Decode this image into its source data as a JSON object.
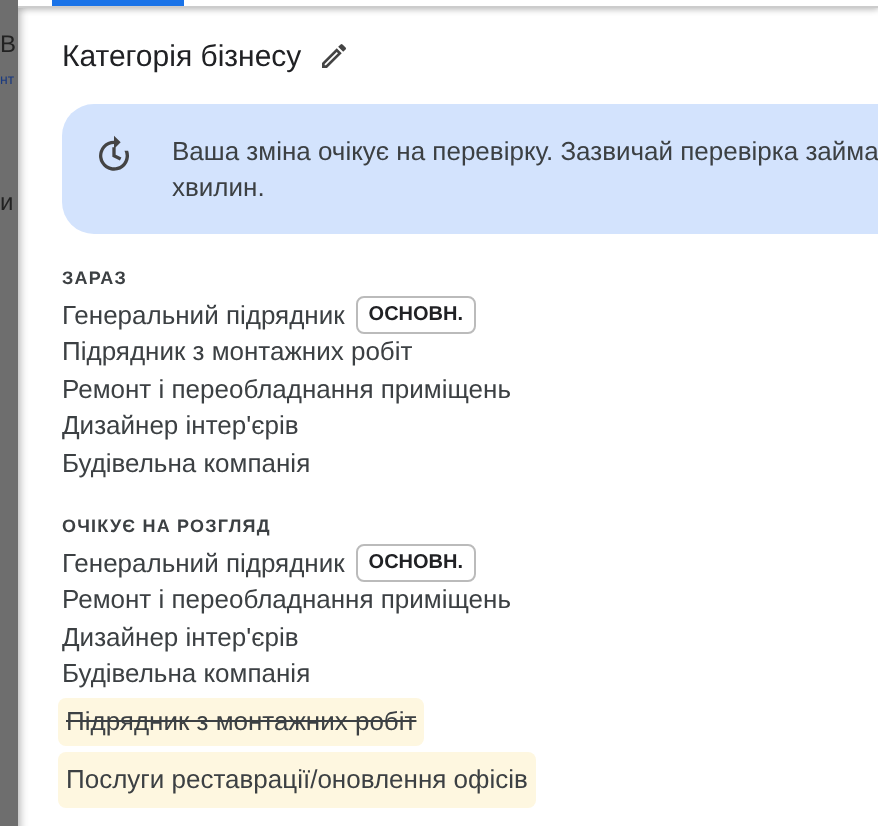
{
  "background_fragments": [
    "В",
    "нт",
    "и"
  ],
  "title": "Категорія бізнесу",
  "notice": {
    "lines": [
      "Ваша зміна очікує на перевірку. Зазвичай перевірка займа",
      "хвилин."
    ]
  },
  "sections": [
    {
      "heading": "ЗАРАЗ",
      "items": [
        {
          "label": "Генеральний підрядник",
          "badge": "ОСНОВН.",
          "kind": "normal"
        },
        {
          "label": "Підрядник з монтажних робіт",
          "kind": "normal"
        },
        {
          "label": "Ремонт і переобладнання приміщень",
          "kind": "normal"
        },
        {
          "label": "Дизайнер інтер'єрів",
          "kind": "normal"
        },
        {
          "label": "Будівельна компанія",
          "kind": "normal"
        }
      ]
    },
    {
      "heading": "ОЧІКУЄ НА РОЗГЛЯД",
      "items": [
        {
          "label": "Генеральний підрядник",
          "badge": "ОСНОВН.",
          "kind": "normal"
        },
        {
          "label": "Ремонт і переобладнання приміщень",
          "kind": "normal"
        },
        {
          "label": "Дизайнер інтер'єрів",
          "kind": "normal"
        },
        {
          "label": "Будівельна компанія",
          "kind": "normal"
        },
        {
          "label": "Підрядник з монтажних робіт",
          "kind": "removed"
        },
        {
          "label": "Послуги реставрації/оновлення офісів",
          "kind": "added"
        }
      ]
    }
  ]
}
